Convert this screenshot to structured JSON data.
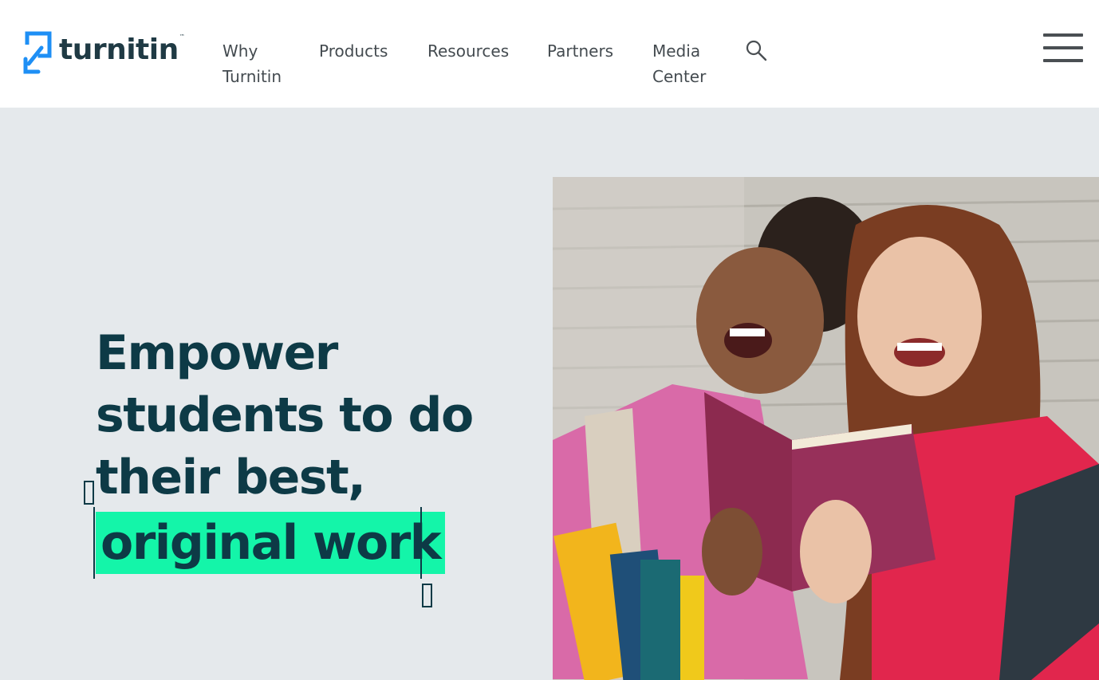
{
  "header": {
    "logo": {
      "text": "turnitin",
      "tm": "™",
      "icon": "turnitin-logo-icon"
    },
    "nav": [
      {
        "line1": "Why",
        "line2": "Turnitin"
      },
      {
        "line1": "Products"
      },
      {
        "line1": "Resources"
      },
      {
        "line1": "Partners"
      },
      {
        "line1": "Media",
        "line2": "Center"
      }
    ],
    "search_icon": "search-icon",
    "menu_icon": "hamburger-menu-icon"
  },
  "hero": {
    "lines": [
      "Empower",
      "students to do",
      "their best,"
    ],
    "highlight": "original work",
    "photo": "two-smiling-students-reading-book-photo"
  },
  "colors": {
    "brand_blue": "#1e8ff5",
    "heading": "#0d3a46",
    "highlight": "#14f5a9",
    "hero_bg": "#e5e9ec"
  }
}
